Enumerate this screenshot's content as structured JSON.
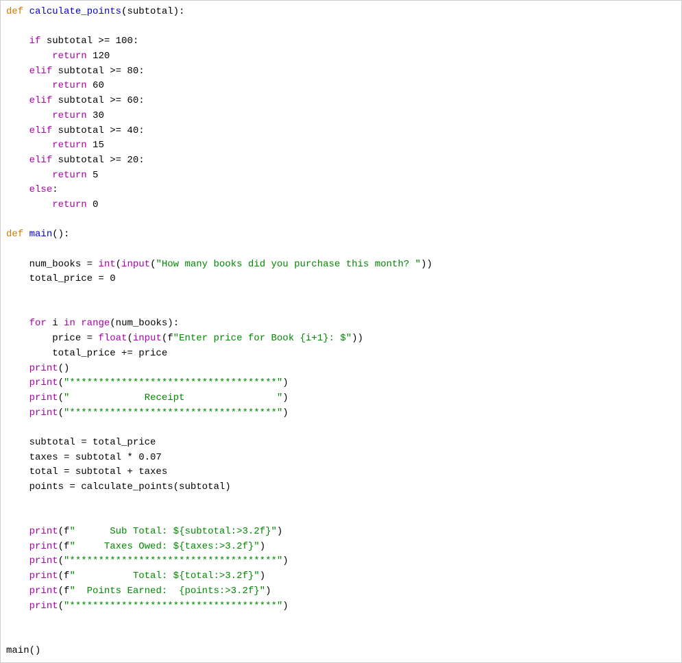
{
  "code": {
    "l01": {
      "def": "def",
      "fn": "calculate_points",
      "paren1": "(subtotal):"
    },
    "l02": "",
    "l03": {
      "kw": "if",
      "rest": " subtotal >= 100:"
    },
    "l04": {
      "kw": "return",
      "rest": " 120"
    },
    "l05": {
      "kw": "elif",
      "rest": " subtotal >= 80:"
    },
    "l06": {
      "kw": "return",
      "rest": " 60"
    },
    "l07": {
      "kw": "elif",
      "rest": " subtotal >= 60:"
    },
    "l08": {
      "kw": "return",
      "rest": " 30"
    },
    "l09": {
      "kw": "elif",
      "rest": " subtotal >= 40:"
    },
    "l10": {
      "kw": "return",
      "rest": " 15"
    },
    "l11": {
      "kw": "elif",
      "rest": " subtotal >= 20:"
    },
    "l12": {
      "kw": "return",
      "rest": " 5"
    },
    "l13": {
      "kw": "else",
      "rest": ":"
    },
    "l14": {
      "kw": "return",
      "rest": " 0"
    },
    "l15": "",
    "l16": {
      "def": "def",
      "fn": "main",
      "paren1": "():"
    },
    "l17": "",
    "l18": {
      "pre": "    num_books = ",
      "b1": "int",
      "p1": "(",
      "b2": "input",
      "p2": "(",
      "str": "\"How many books did you purchase this month? \"",
      "p3": "))"
    },
    "l19": "    total_price = 0",
    "l20": "",
    "l21": "",
    "l22": {
      "kw1": "for",
      "mid1": " i ",
      "kw2": "in",
      "mid2": " ",
      "b1": "range",
      "rest": "(num_books):"
    },
    "l23": {
      "pre": "        price = ",
      "b1": "float",
      "p1": "(",
      "b2": "input",
      "p2": "(f",
      "str": "\"Enter price for Book {i+1}: $\"",
      "p3": "))"
    },
    "l24": "        total_price += price",
    "l25": {
      "b1": "print",
      "rest": "()"
    },
    "l26": {
      "b1": "print",
      "p1": "(",
      "str": "\"************************************\"",
      "p2": ")"
    },
    "l27": {
      "b1": "print",
      "p1": "(",
      "str": "\"             Receipt                \"",
      "p2": ")"
    },
    "l28": {
      "b1": "print",
      "p1": "(",
      "str": "\"************************************\"",
      "p2": ")"
    },
    "l29": "",
    "l30": "    subtotal = total_price",
    "l31": "    taxes = subtotal * 0.07",
    "l32": "    total = subtotal + taxes",
    "l33": "    points = calculate_points(subtotal)",
    "l34": "",
    "l35": "",
    "l36": {
      "b1": "print",
      "p1": "(f",
      "str": "\"      Sub Total: ${subtotal:>3.2f}\"",
      "p2": ")"
    },
    "l37": {
      "b1": "print",
      "p1": "(f",
      "str": "\"     Taxes Owed: ${taxes:>3.2f}\"",
      "p2": ")"
    },
    "l38": {
      "b1": "print",
      "p1": "(",
      "str": "\"************************************\"",
      "p2": ")"
    },
    "l39": {
      "b1": "print",
      "p1": "(f",
      "str": "\"          Total: ${total:>3.2f}\"",
      "p2": ")"
    },
    "l40": {
      "b1": "print",
      "p1": "(f",
      "str": "\"  Points Earned:  {points:>3.2f}\"",
      "p2": ")"
    },
    "l41": {
      "b1": "print",
      "p1": "(",
      "str": "\"************************************\"",
      "p2": ")"
    },
    "l42": "",
    "l43": "",
    "l44": "main()"
  }
}
